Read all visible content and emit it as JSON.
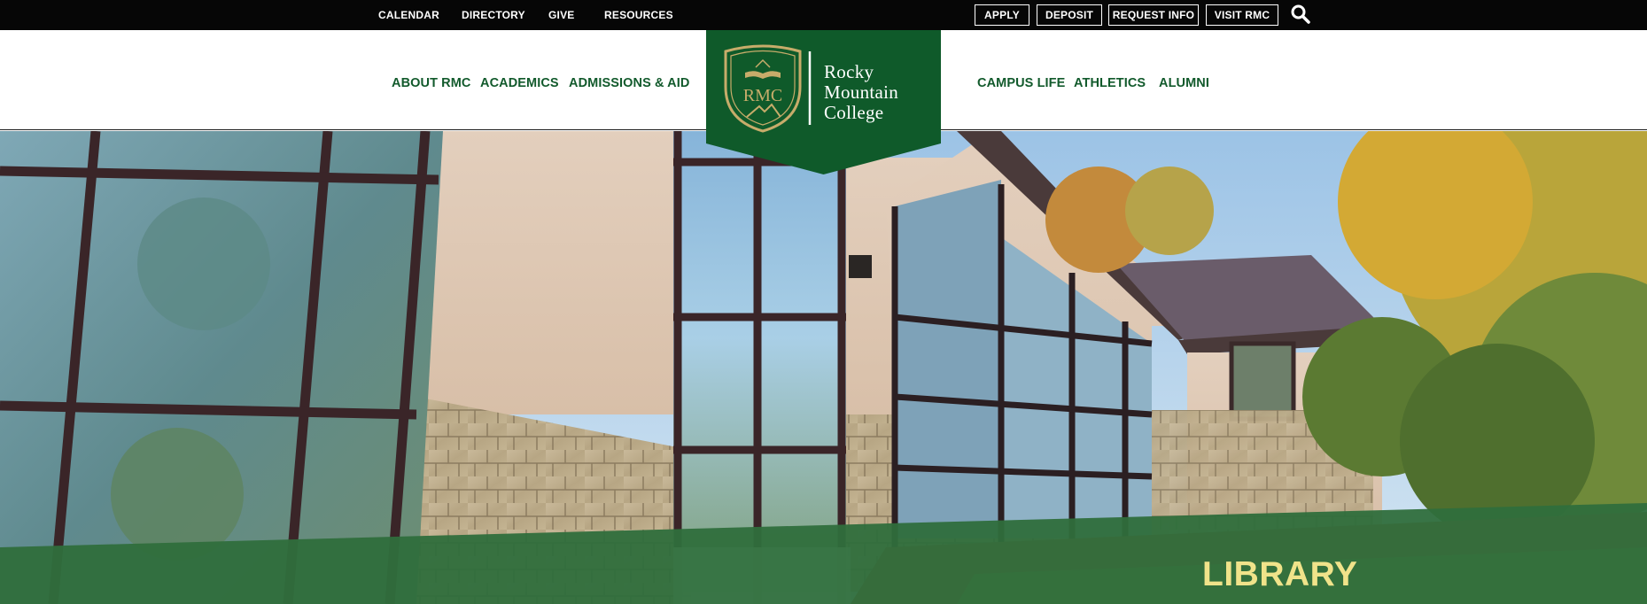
{
  "utility_nav": {
    "links": [
      "CALENDAR",
      "DIRECTORY",
      "GIVE",
      "RESOURCES"
    ],
    "buttons": [
      "APPLY",
      "DEPOSIT",
      "REQUEST INFO",
      "VISIT RMC"
    ],
    "search_icon": "search-icon"
  },
  "main_nav": {
    "left": [
      "ABOUT RMC",
      "ACADEMICS",
      "ADMISSIONS & AID"
    ],
    "right": [
      "CAMPUS LIFE",
      "ATHLETICS",
      "ALUMNI"
    ]
  },
  "logo": {
    "monogram": "RMC",
    "name_lines": [
      "Rocky",
      "Mountain",
      "College"
    ]
  },
  "hero": {
    "title": "LIBRARY"
  },
  "colors": {
    "brand_green": "#125a2c",
    "logo_green": "#0f5a2a",
    "band_green": "#2f6e3c",
    "title_yellow": "#f0e38a",
    "gold": "#c7ac6a"
  }
}
